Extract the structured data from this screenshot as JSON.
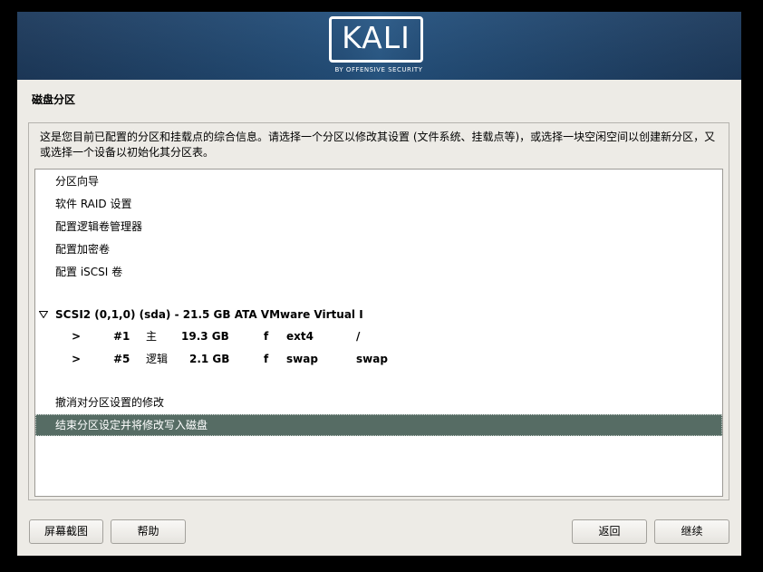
{
  "banner": {
    "logo_text": "KALI",
    "logo_subtext": "BY OFFENSIVE SECURITY"
  },
  "page": {
    "title": "磁盘分区",
    "description": "这是您目前已配置的分区和挂载点的综合信息。请选择一个分区以修改其设置 (文件系统、挂载点等)，或选择一块空闲空间以创建新分区，又或选择一个设备以初始化其分区表。"
  },
  "menu": {
    "items": [
      {
        "label": "分区向导"
      },
      {
        "label": "软件 RAID 设置"
      },
      {
        "label": "配置逻辑卷管理器"
      },
      {
        "label": "配置加密卷"
      },
      {
        "label": "配置 iSCSI 卷"
      }
    ]
  },
  "disk": {
    "label": "SCSI2 (0,1,0) (sda) - 21.5 GB ATA VMware Virtual I",
    "partitions": [
      {
        "arrow": ">",
        "number": "#1",
        "type": "主",
        "size": "19.3 GB",
        "flag": "f",
        "fs": "ext4",
        "mount": "/"
      },
      {
        "arrow": ">",
        "number": "#5",
        "type": "逻辑",
        "size": "2.1 GB",
        "flag": "f",
        "fs": "swap",
        "mount": "swap"
      }
    ]
  },
  "actions": {
    "undo": "撤消对分区设置的修改",
    "finish": "结束分区设定并将修改写入磁盘"
  },
  "buttons": {
    "screenshot": "屏幕截图",
    "help": "帮助",
    "back": "返回",
    "continue": "继续"
  }
}
